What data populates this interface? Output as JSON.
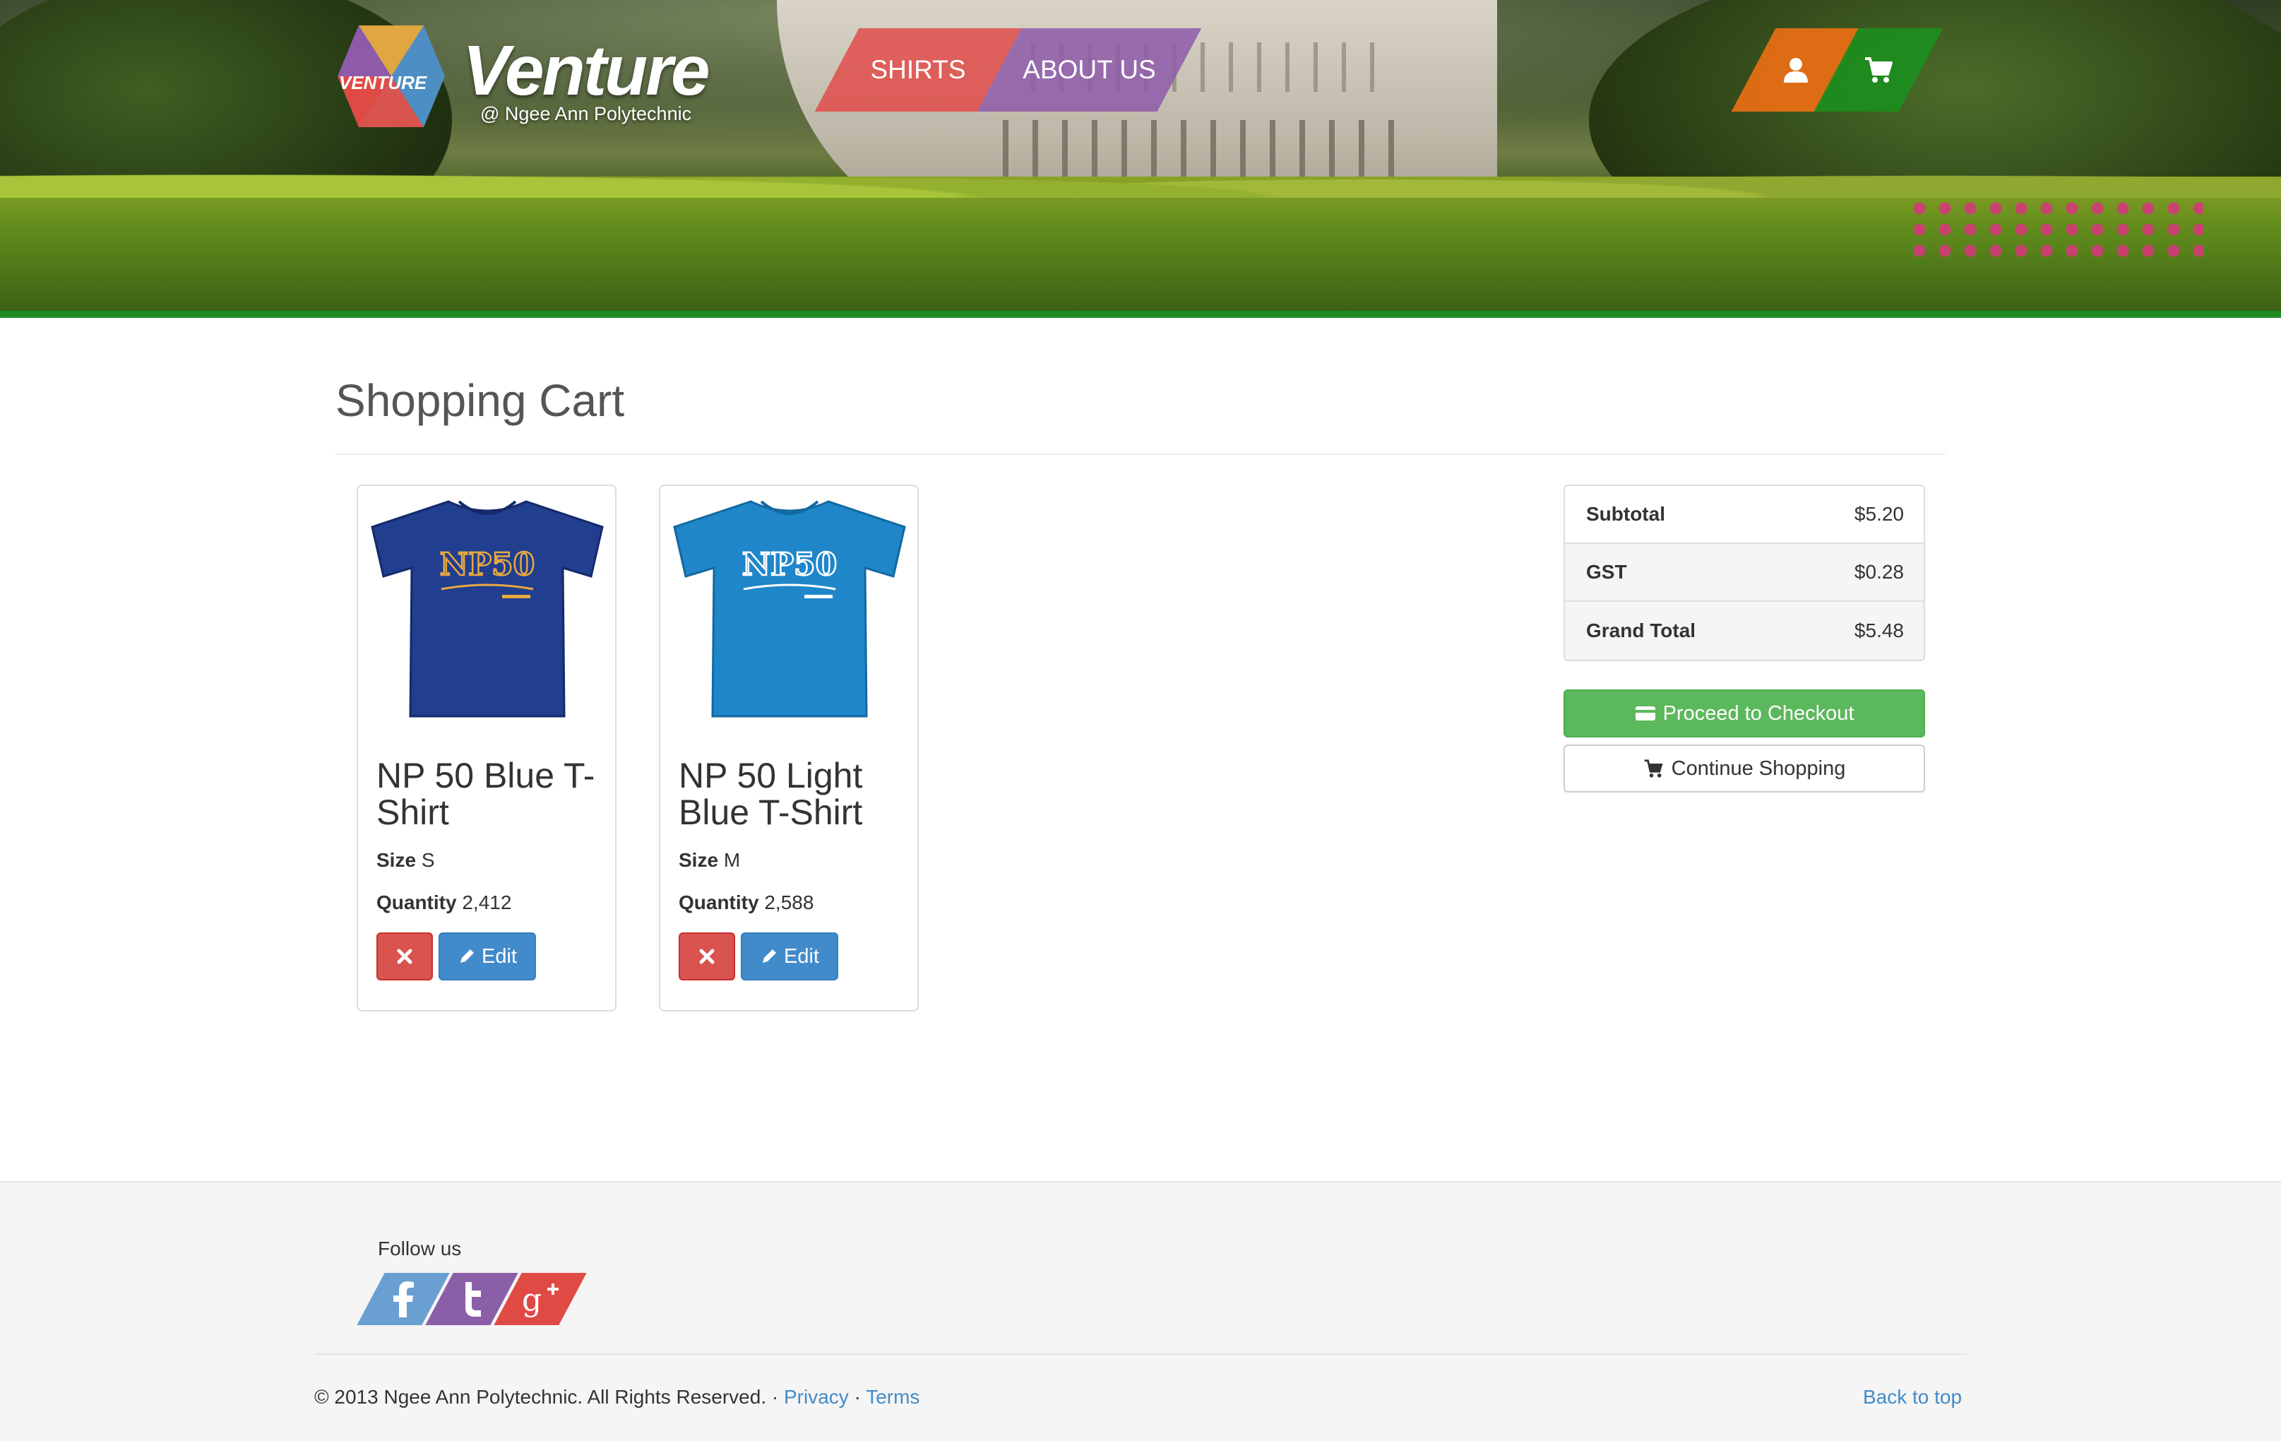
{
  "brand": {
    "logo_badge": "VENTURE",
    "name": "Venture",
    "tagline": "@ Ngee Ann Polytechnic"
  },
  "nav": {
    "items": [
      {
        "label": "SHIRTS",
        "color": "#e04c4a"
      },
      {
        "label": "ABOUT US",
        "color": "#8e5aaa"
      }
    ],
    "icons": [
      {
        "icon": "user-icon",
        "color": "#e66e14"
      },
      {
        "icon": "cart-icon",
        "color": "#1e8c1e"
      }
    ]
  },
  "page": {
    "title": "Shopping Cart"
  },
  "cart": {
    "items": [
      {
        "name": "NP 50 Blue T-Shirt",
        "size_label": "Size",
        "size": "S",
        "quantity_label": "Quantity",
        "quantity": "2,412",
        "shirt_color": "#213e8f",
        "print_text": "NP50",
        "print_color": "#e8a940",
        "edit_label": "Edit"
      },
      {
        "name": "NP 50 Light Blue T-Shirt",
        "size_label": "Size",
        "size": "M",
        "quantity_label": "Quantity",
        "quantity": "2,588",
        "shirt_color": "#1e86c9",
        "print_text": "NP50",
        "print_color": "#ffffff",
        "edit_label": "Edit"
      }
    ]
  },
  "summary": {
    "rows": [
      {
        "label": "Subtotal",
        "value": "$5.20"
      },
      {
        "label": "GST",
        "value": "$0.28"
      },
      {
        "label": "Grand Total",
        "value": "$5.48"
      }
    ],
    "checkout_label": "Proceed to Checkout",
    "continue_label": "Continue Shopping"
  },
  "footer": {
    "follow_label": "Follow us",
    "social": [
      {
        "icon": "facebook-icon",
        "color": "#6a9fd1"
      },
      {
        "icon": "twitter-icon",
        "color": "#8b5ea8"
      },
      {
        "icon": "google-plus-icon",
        "color": "#e04a45"
      }
    ],
    "copyright": "© 2013 Ngee Ann Polytechnic. All Rights Reserved. ·",
    "privacy_label": "Privacy",
    "separator": "·",
    "terms_label": "Terms",
    "back_to_top": "Back to top"
  },
  "colors": {
    "accent_green": "#1f8a1f",
    "danger": "#d9534f",
    "primary": "#428bca",
    "success": "#5cb85c"
  }
}
